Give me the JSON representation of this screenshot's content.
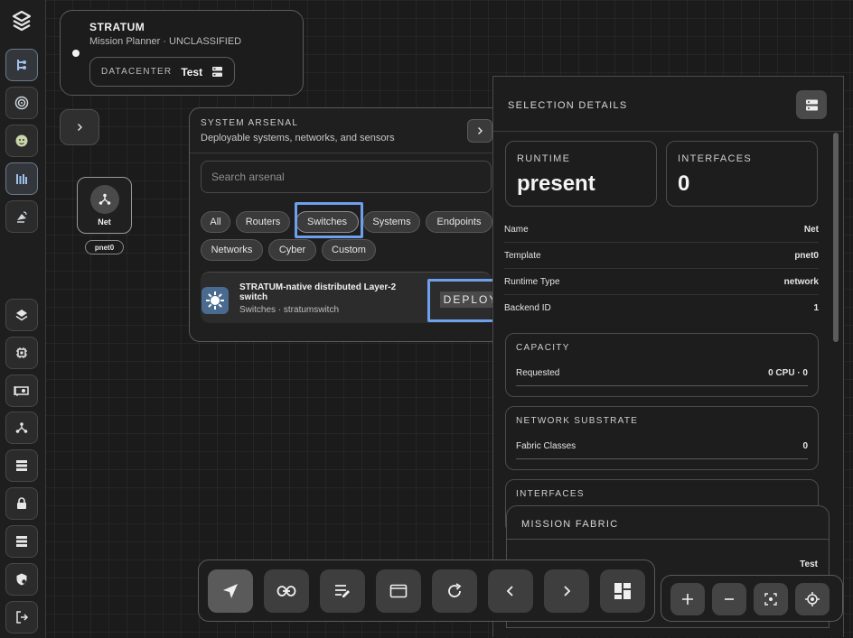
{
  "header": {
    "app_name": "STRATUM",
    "subtitle": "Mission Planner · UNCLASSIFIED",
    "datacenter_label": "DATACENTER",
    "datacenter_value": "Test"
  },
  "canvas": {
    "node": {
      "label": "Net",
      "tag": "pnet0",
      "icon": "network-hub-icon"
    }
  },
  "arsenal": {
    "title": "SYSTEM ARSENAL",
    "subtitle": "Deployable systems, networks, and sensors",
    "search_placeholder": "Search arsenal",
    "filters": [
      "All",
      "Routers",
      "Switches",
      "Systems",
      "Endpoints",
      "Networks",
      "Cyber",
      "Custom"
    ],
    "selected_filter": "Switches",
    "results": [
      {
        "title": "STRATUM-native distributed Layer-2 switch",
        "subtitle": "Switches · stratumswitch",
        "action": "DEPLOY",
        "icon": "sun-switch-icon"
      }
    ]
  },
  "details": {
    "title": "SELECTION DETAILS",
    "runtime": {
      "label": "RUNTIME",
      "value": "present"
    },
    "interfaces_stat": {
      "label": "INTERFACES",
      "value": "0"
    },
    "fields": [
      {
        "key": "Name",
        "value": "Net"
      },
      {
        "key": "Template",
        "value": "pnet0"
      },
      {
        "key": "Runtime Type",
        "value": "network"
      },
      {
        "key": "Backend ID",
        "value": "1"
      }
    ],
    "capacity": {
      "label": "CAPACITY",
      "row_key": "Requested",
      "row_value": "0 CPU · 0"
    },
    "substrate": {
      "label": "NETWORK SUBSTRATE",
      "row_key": "Fabric Classes",
      "row_value": "0"
    },
    "interfaces_section": {
      "label": "INTERFACES"
    }
  },
  "fabric": {
    "title": "MISSION FABRIC",
    "value": "Test"
  },
  "toolbar": {
    "tools": [
      "pointer-icon",
      "link-icon",
      "edit-list-icon",
      "window-icon",
      "refresh-icon",
      "chevron-left-icon",
      "chevron-right-icon",
      "dashboard-icon"
    ]
  },
  "zoom": {
    "tools": [
      "zoom-in-icon",
      "zoom-out-icon",
      "fit-view-icon",
      "locate-icon"
    ]
  },
  "colors": {
    "accent_focus": "#6ea0ee",
    "switch_icon_bg": "#4b6a8f"
  }
}
